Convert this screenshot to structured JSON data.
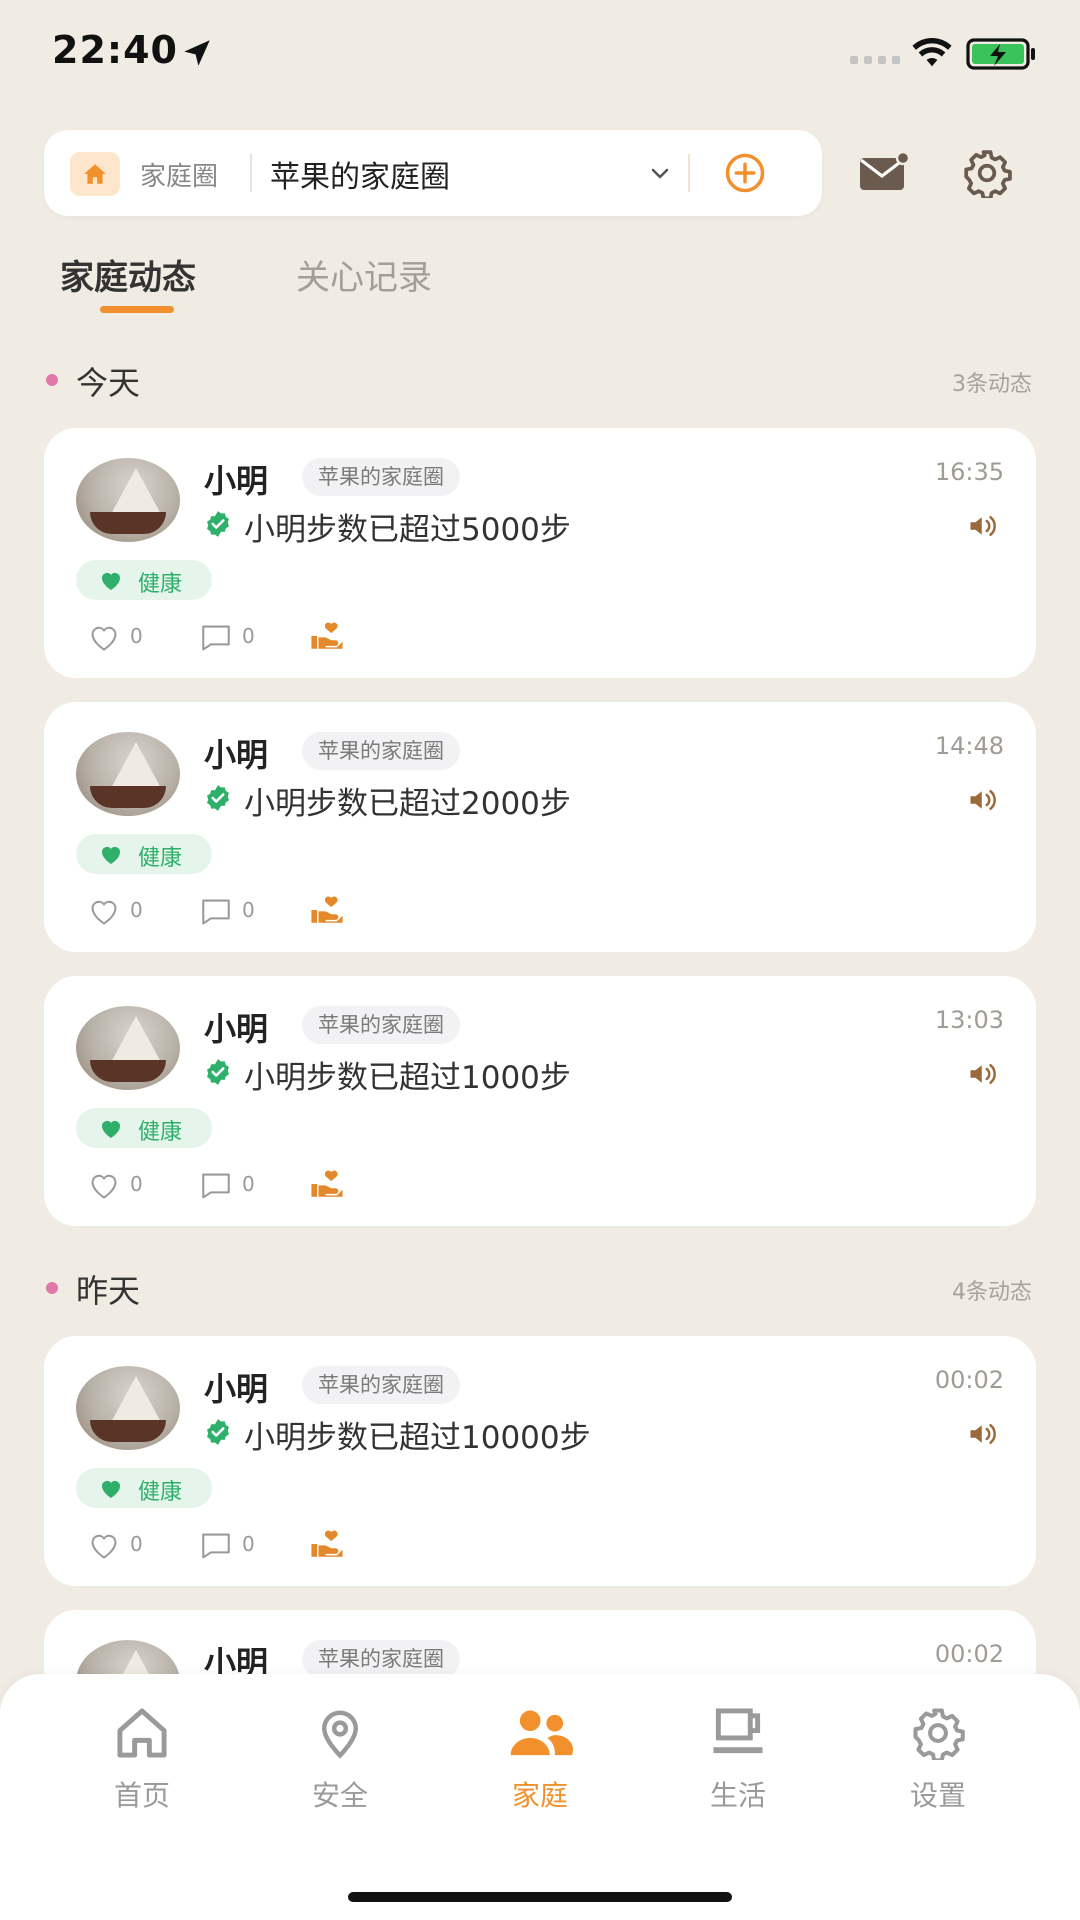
{
  "status": {
    "time": "22:40"
  },
  "header": {
    "circle_label": "家庭圈",
    "circle_name": "苹果的家庭圈"
  },
  "tabs": [
    {
      "label": "家庭动态",
      "active": true
    },
    {
      "label": "关心记录",
      "active": false
    }
  ],
  "sections": [
    {
      "title": "今天",
      "count": "3条动态"
    },
    {
      "title": "昨天",
      "count": "4条动态"
    }
  ],
  "feed": [
    {
      "name": "小明",
      "circle": "苹果的家庭圈",
      "time": "16:35",
      "message": "小明步数已超过5000步",
      "tag": "健康",
      "likes": "0",
      "comments": "0"
    },
    {
      "name": "小明",
      "circle": "苹果的家庭圈",
      "time": "14:48",
      "message": "小明步数已超过2000步",
      "tag": "健康",
      "likes": "0",
      "comments": "0"
    },
    {
      "name": "小明",
      "circle": "苹果的家庭圈",
      "time": "13:03",
      "message": "小明步数已超过1000步",
      "tag": "健康",
      "likes": "0",
      "comments": "0"
    },
    {
      "name": "小明",
      "circle": "苹果的家庭圈",
      "time": "00:02",
      "message": "小明步数已超过10000步",
      "tag": "健康",
      "likes": "0",
      "comments": "0"
    },
    {
      "name": "小明",
      "circle": "苹果的家庭圈",
      "time": "00:02"
    }
  ],
  "nav": [
    {
      "label": "首页",
      "icon": "home-icon",
      "active": false
    },
    {
      "label": "安全",
      "icon": "location-pin-icon",
      "active": false
    },
    {
      "label": "家庭",
      "icon": "family-icon",
      "active": true
    },
    {
      "label": "生活",
      "icon": "coffee-cup-icon",
      "active": false
    },
    {
      "label": "设置",
      "icon": "gear-icon",
      "active": false
    }
  ],
  "colors": {
    "accent": "#f1902c",
    "health": "#2fb06a",
    "background": "#f1ece3"
  }
}
